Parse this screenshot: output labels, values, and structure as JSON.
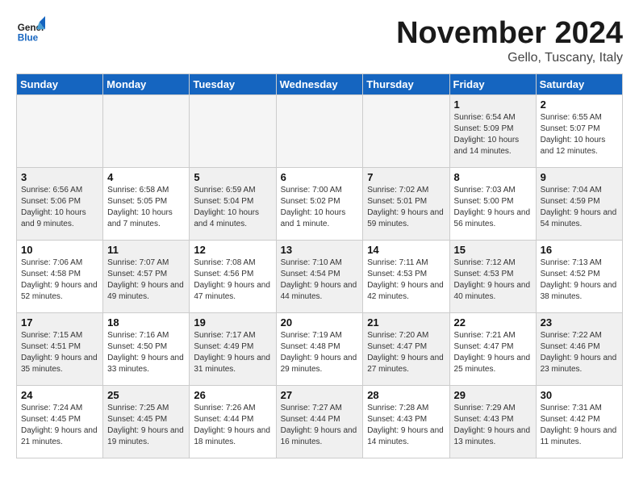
{
  "header": {
    "logo_line1": "General",
    "logo_line2": "Blue",
    "month": "November 2024",
    "location": "Gello, Tuscany, Italy"
  },
  "weekdays": [
    "Sunday",
    "Monday",
    "Tuesday",
    "Wednesday",
    "Thursday",
    "Friday",
    "Saturday"
  ],
  "weeks": [
    [
      {
        "day": "",
        "info": "",
        "shaded": false,
        "empty": true
      },
      {
        "day": "",
        "info": "",
        "shaded": false,
        "empty": true
      },
      {
        "day": "",
        "info": "",
        "shaded": false,
        "empty": true
      },
      {
        "day": "",
        "info": "",
        "shaded": false,
        "empty": true
      },
      {
        "day": "",
        "info": "",
        "shaded": false,
        "empty": true
      },
      {
        "day": "1",
        "info": "Sunrise: 6:54 AM\nSunset: 5:09 PM\nDaylight: 10 hours and 14 minutes.",
        "shaded": true,
        "empty": false
      },
      {
        "day": "2",
        "info": "Sunrise: 6:55 AM\nSunset: 5:07 PM\nDaylight: 10 hours and 12 minutes.",
        "shaded": false,
        "empty": false
      }
    ],
    [
      {
        "day": "3",
        "info": "Sunrise: 6:56 AM\nSunset: 5:06 PM\nDaylight: 10 hours and 9 minutes.",
        "shaded": true,
        "empty": false
      },
      {
        "day": "4",
        "info": "Sunrise: 6:58 AM\nSunset: 5:05 PM\nDaylight: 10 hours and 7 minutes.",
        "shaded": false,
        "empty": false
      },
      {
        "day": "5",
        "info": "Sunrise: 6:59 AM\nSunset: 5:04 PM\nDaylight: 10 hours and 4 minutes.",
        "shaded": true,
        "empty": false
      },
      {
        "day": "6",
        "info": "Sunrise: 7:00 AM\nSunset: 5:02 PM\nDaylight: 10 hours and 1 minute.",
        "shaded": false,
        "empty": false
      },
      {
        "day": "7",
        "info": "Sunrise: 7:02 AM\nSunset: 5:01 PM\nDaylight: 9 hours and 59 minutes.",
        "shaded": true,
        "empty": false
      },
      {
        "day": "8",
        "info": "Sunrise: 7:03 AM\nSunset: 5:00 PM\nDaylight: 9 hours and 56 minutes.",
        "shaded": false,
        "empty": false
      },
      {
        "day": "9",
        "info": "Sunrise: 7:04 AM\nSunset: 4:59 PM\nDaylight: 9 hours and 54 minutes.",
        "shaded": true,
        "empty": false
      }
    ],
    [
      {
        "day": "10",
        "info": "Sunrise: 7:06 AM\nSunset: 4:58 PM\nDaylight: 9 hours and 52 minutes.",
        "shaded": false,
        "empty": false
      },
      {
        "day": "11",
        "info": "Sunrise: 7:07 AM\nSunset: 4:57 PM\nDaylight: 9 hours and 49 minutes.",
        "shaded": true,
        "empty": false
      },
      {
        "day": "12",
        "info": "Sunrise: 7:08 AM\nSunset: 4:56 PM\nDaylight: 9 hours and 47 minutes.",
        "shaded": false,
        "empty": false
      },
      {
        "day": "13",
        "info": "Sunrise: 7:10 AM\nSunset: 4:54 PM\nDaylight: 9 hours and 44 minutes.",
        "shaded": true,
        "empty": false
      },
      {
        "day": "14",
        "info": "Sunrise: 7:11 AM\nSunset: 4:53 PM\nDaylight: 9 hours and 42 minutes.",
        "shaded": false,
        "empty": false
      },
      {
        "day": "15",
        "info": "Sunrise: 7:12 AM\nSunset: 4:53 PM\nDaylight: 9 hours and 40 minutes.",
        "shaded": true,
        "empty": false
      },
      {
        "day": "16",
        "info": "Sunrise: 7:13 AM\nSunset: 4:52 PM\nDaylight: 9 hours and 38 minutes.",
        "shaded": false,
        "empty": false
      }
    ],
    [
      {
        "day": "17",
        "info": "Sunrise: 7:15 AM\nSunset: 4:51 PM\nDaylight: 9 hours and 35 minutes.",
        "shaded": true,
        "empty": false
      },
      {
        "day": "18",
        "info": "Sunrise: 7:16 AM\nSunset: 4:50 PM\nDaylight: 9 hours and 33 minutes.",
        "shaded": false,
        "empty": false
      },
      {
        "day": "19",
        "info": "Sunrise: 7:17 AM\nSunset: 4:49 PM\nDaylight: 9 hours and 31 minutes.",
        "shaded": true,
        "empty": false
      },
      {
        "day": "20",
        "info": "Sunrise: 7:19 AM\nSunset: 4:48 PM\nDaylight: 9 hours and 29 minutes.",
        "shaded": false,
        "empty": false
      },
      {
        "day": "21",
        "info": "Sunrise: 7:20 AM\nSunset: 4:47 PM\nDaylight: 9 hours and 27 minutes.",
        "shaded": true,
        "empty": false
      },
      {
        "day": "22",
        "info": "Sunrise: 7:21 AM\nSunset: 4:47 PM\nDaylight: 9 hours and 25 minutes.",
        "shaded": false,
        "empty": false
      },
      {
        "day": "23",
        "info": "Sunrise: 7:22 AM\nSunset: 4:46 PM\nDaylight: 9 hours and 23 minutes.",
        "shaded": true,
        "empty": false
      }
    ],
    [
      {
        "day": "24",
        "info": "Sunrise: 7:24 AM\nSunset: 4:45 PM\nDaylight: 9 hours and 21 minutes.",
        "shaded": false,
        "empty": false
      },
      {
        "day": "25",
        "info": "Sunrise: 7:25 AM\nSunset: 4:45 PM\nDaylight: 9 hours and 19 minutes.",
        "shaded": true,
        "empty": false
      },
      {
        "day": "26",
        "info": "Sunrise: 7:26 AM\nSunset: 4:44 PM\nDaylight: 9 hours and 18 minutes.",
        "shaded": false,
        "empty": false
      },
      {
        "day": "27",
        "info": "Sunrise: 7:27 AM\nSunset: 4:44 PM\nDaylight: 9 hours and 16 minutes.",
        "shaded": true,
        "empty": false
      },
      {
        "day": "28",
        "info": "Sunrise: 7:28 AM\nSunset: 4:43 PM\nDaylight: 9 hours and 14 minutes.",
        "shaded": false,
        "empty": false
      },
      {
        "day": "29",
        "info": "Sunrise: 7:29 AM\nSunset: 4:43 PM\nDaylight: 9 hours and 13 minutes.",
        "shaded": true,
        "empty": false
      },
      {
        "day": "30",
        "info": "Sunrise: 7:31 AM\nSunset: 4:42 PM\nDaylight: 9 hours and 11 minutes.",
        "shaded": false,
        "empty": false
      }
    ]
  ]
}
